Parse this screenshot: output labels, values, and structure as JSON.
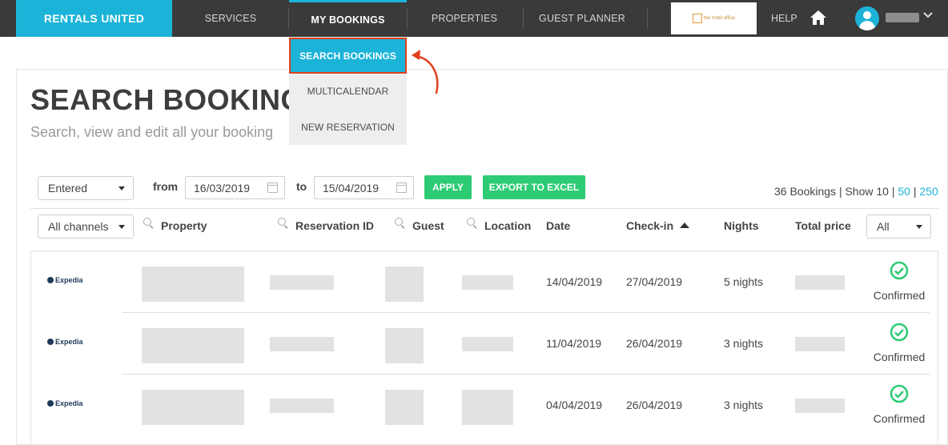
{
  "nav": {
    "brand": "RENTALS UNITED",
    "items": [
      "SERVICES",
      "MY BOOKINGS",
      "PROPERTIES",
      "GUEST PLANNER"
    ],
    "help": "HELP",
    "logo_text": "the hotel office"
  },
  "dropdown": {
    "items": [
      "SEARCH BOOKINGS",
      "MULTICALENDAR",
      "NEW RESERVATION"
    ]
  },
  "page": {
    "title": "SEARCH BOOKINGS",
    "subtitle": "Search, view and edit all your booking"
  },
  "filters": {
    "date_type": "Entered",
    "from_label": "from",
    "from_value": "16/03/2019",
    "to_label": "to",
    "to_value": "15/04/2019",
    "apply": "APPLY",
    "export": "EXPORT TO EXCEL"
  },
  "summary": {
    "text": "36 Bookings | Show 10 | ",
    "link_50": "50",
    "sep": " | ",
    "link_250": "250"
  },
  "table": {
    "channels": "All channels",
    "status_filter": "All",
    "headers": {
      "property": "Property",
      "reservation_id": "Reservation ID",
      "guest": "Guest",
      "location": "Location",
      "date": "Date",
      "checkin": "Check-in",
      "nights": "Nights",
      "total_price": "Total price"
    },
    "rows": [
      {
        "channel": "Expedia",
        "date": "14/04/2019",
        "checkin": "27/04/2019",
        "nights": "5 nights",
        "status": "Confirmed"
      },
      {
        "channel": "Expedia",
        "date": "11/04/2019",
        "checkin": "26/04/2019",
        "nights": "3 nights",
        "status": "Confirmed"
      },
      {
        "channel": "Expedia",
        "date": "04/04/2019",
        "checkin": "26/04/2019",
        "nights": "3 nights",
        "status": "Confirmed"
      }
    ]
  },
  "colors": {
    "accent": "#1cb3d8",
    "nav_bg": "#3a3a3a",
    "green": "#2dcb74",
    "highlight": "#e0401e"
  }
}
